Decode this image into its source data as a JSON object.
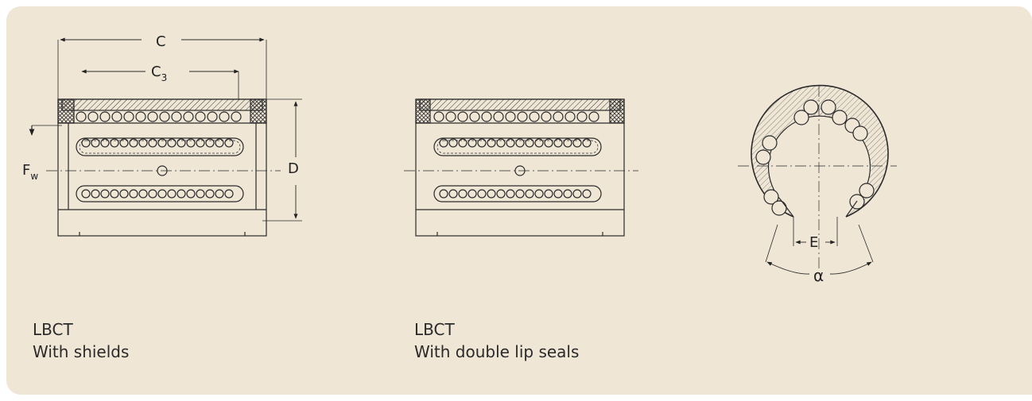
{
  "labels": {
    "C": "C",
    "C3": "C",
    "C3_sub": "3",
    "D": "D",
    "Fw": "F",
    "Fw_sub": "w",
    "E": "E",
    "alpha": "α"
  },
  "captions": [
    {
      "model": "LBCT",
      "variant": "With shields"
    },
    {
      "model": "LBCT",
      "variant": "With double lip seals"
    }
  ],
  "colors": {
    "panel": "#efe6d6",
    "line": "#2a2a2a"
  }
}
